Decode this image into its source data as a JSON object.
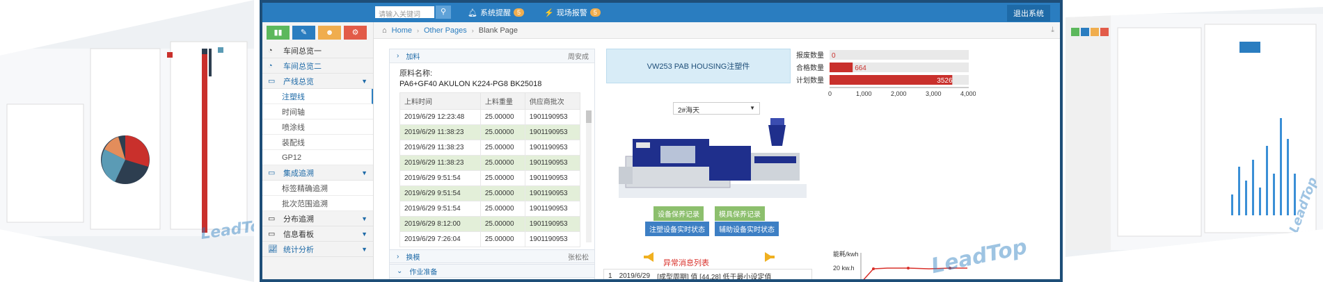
{
  "topbar": {
    "search_placeholder": "请输入关键词",
    "alerts": [
      {
        "label": "系统提醒",
        "count": "5"
      },
      {
        "label": "现场报警",
        "count": "5"
      }
    ],
    "logout_label": "退出系统"
  },
  "shortcuts": [
    {
      "icon": "bar-chart-icon",
      "color": "#5cb85c",
      "glyph": "▮"
    },
    {
      "icon": "pencil-icon",
      "color": "#2a7dc0",
      "glyph": "✎"
    },
    {
      "icon": "users-icon",
      "color": "#f0ad4e",
      "glyph": "☻"
    },
    {
      "icon": "cogs-icon",
      "color": "#e25b48",
      "glyph": "⚙"
    }
  ],
  "sidebar": {
    "items": [
      {
        "label": "车间总览一",
        "icon": "dashboard-icon"
      },
      {
        "label": "车间总览二",
        "icon": "dashboard-icon"
      },
      {
        "label": "产线总览",
        "icon": "monitor-icon"
      },
      {
        "label": "集成追溯",
        "icon": "monitor-icon"
      },
      {
        "label": "分布追溯",
        "icon": "laptop-icon"
      },
      {
        "label": "信息看板",
        "icon": "laptop-icon"
      },
      {
        "label": "统计分析",
        "icon": "line-chart-icon"
      }
    ],
    "sub_line": [
      "注塑线",
      "时间轴",
      "喷涂线",
      "装配线",
      "GP12"
    ],
    "sub_trace": [
      "标签精确追溯",
      "批次范围追溯"
    ]
  },
  "breadcrumb": {
    "home": "Home",
    "middle": "Other Pages",
    "current": "Blank Page"
  },
  "feeding": {
    "title": "加料",
    "person": "周安成",
    "material_label": "原料名称:",
    "material_value": "PA6+GF40 AKULON K224-PG8 BK25018",
    "columns": [
      "上料时间",
      "上料重量",
      "供应商批次"
    ],
    "rows": [
      [
        "2019/6/29 12:23:48",
        "25.00000",
        "1901190953"
      ],
      [
        "2019/6/29 11:38:23",
        "25.00000",
        "1901190953"
      ],
      [
        "2019/6/29 11:38:23",
        "25.00000",
        "1901190953"
      ],
      [
        "2019/6/29 11:38:23",
        "25.00000",
        "1901190953"
      ],
      [
        "2019/6/29 9:51:54",
        "25.00000",
        "1901190953"
      ],
      [
        "2019/6/29 9:51:54",
        "25.00000",
        "1901190953"
      ],
      [
        "2019/6/29 9:51:54",
        "25.00000",
        "1901190953"
      ],
      [
        "2019/6/29 8:12:00",
        "25.00000",
        "1901190953"
      ],
      [
        "2019/6/29 7:26:04",
        "25.00000",
        "1901190953"
      ]
    ],
    "changeover_title": "换模",
    "changeover_person": "张松松",
    "prep_title": "作业准备"
  },
  "machine": {
    "banner": "VW253 PAB HOUSING注塑件",
    "select_value": "2#海天",
    "buttons": [
      "设备保养记录",
      "模具保养记录",
      "注塑设备实时状态",
      "辅助设备实时状态"
    ]
  },
  "alarm": {
    "title": "异常消息列表",
    "row": {
      "index": "1",
      "date": "2019/6/29",
      "text": "[成型周期] 值 [44.28] 低于最小设定值"
    }
  },
  "chart_data": [
    {
      "type": "bar",
      "orientation": "horizontal",
      "categories": [
        "报废数量",
        "合格数量",
        "计划数量"
      ],
      "values": [
        0,
        664,
        3526
      ],
      "xlim": [
        0,
        4000
      ],
      "xticks": [
        0,
        1000,
        2000,
        3000,
        4000
      ],
      "colors": [
        "#c9302c"
      ]
    },
    {
      "type": "line",
      "ylabel": "能耗/kwh",
      "ytick_label": "20 kw.h"
    }
  ],
  "watermark": "LeadTop"
}
